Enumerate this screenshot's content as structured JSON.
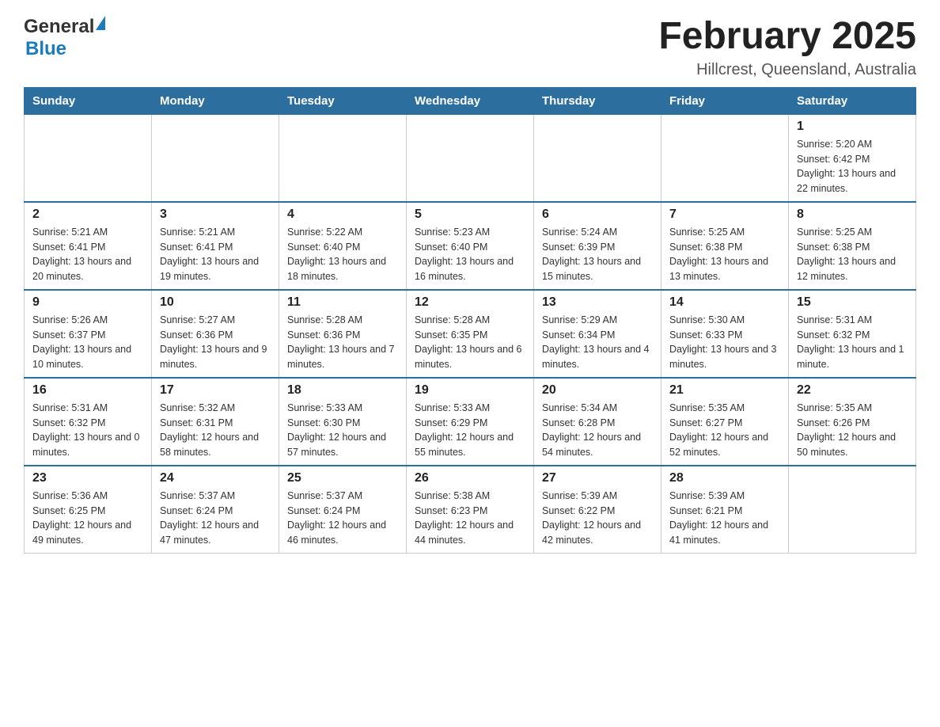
{
  "header": {
    "logo": {
      "general": "General",
      "blue": "Blue"
    },
    "title": "February 2025",
    "subtitle": "Hillcrest, Queensland, Australia"
  },
  "weekdays": [
    "Sunday",
    "Monday",
    "Tuesday",
    "Wednesday",
    "Thursday",
    "Friday",
    "Saturday"
  ],
  "weeks": [
    [
      {
        "day": "",
        "info": ""
      },
      {
        "day": "",
        "info": ""
      },
      {
        "day": "",
        "info": ""
      },
      {
        "day": "",
        "info": ""
      },
      {
        "day": "",
        "info": ""
      },
      {
        "day": "",
        "info": ""
      },
      {
        "day": "1",
        "info": "Sunrise: 5:20 AM\nSunset: 6:42 PM\nDaylight: 13 hours and 22 minutes."
      }
    ],
    [
      {
        "day": "2",
        "info": "Sunrise: 5:21 AM\nSunset: 6:41 PM\nDaylight: 13 hours and 20 minutes."
      },
      {
        "day": "3",
        "info": "Sunrise: 5:21 AM\nSunset: 6:41 PM\nDaylight: 13 hours and 19 minutes."
      },
      {
        "day": "4",
        "info": "Sunrise: 5:22 AM\nSunset: 6:40 PM\nDaylight: 13 hours and 18 minutes."
      },
      {
        "day": "5",
        "info": "Sunrise: 5:23 AM\nSunset: 6:40 PM\nDaylight: 13 hours and 16 minutes."
      },
      {
        "day": "6",
        "info": "Sunrise: 5:24 AM\nSunset: 6:39 PM\nDaylight: 13 hours and 15 minutes."
      },
      {
        "day": "7",
        "info": "Sunrise: 5:25 AM\nSunset: 6:38 PM\nDaylight: 13 hours and 13 minutes."
      },
      {
        "day": "8",
        "info": "Sunrise: 5:25 AM\nSunset: 6:38 PM\nDaylight: 13 hours and 12 minutes."
      }
    ],
    [
      {
        "day": "9",
        "info": "Sunrise: 5:26 AM\nSunset: 6:37 PM\nDaylight: 13 hours and 10 minutes."
      },
      {
        "day": "10",
        "info": "Sunrise: 5:27 AM\nSunset: 6:36 PM\nDaylight: 13 hours and 9 minutes."
      },
      {
        "day": "11",
        "info": "Sunrise: 5:28 AM\nSunset: 6:36 PM\nDaylight: 13 hours and 7 minutes."
      },
      {
        "day": "12",
        "info": "Sunrise: 5:28 AM\nSunset: 6:35 PM\nDaylight: 13 hours and 6 minutes."
      },
      {
        "day": "13",
        "info": "Sunrise: 5:29 AM\nSunset: 6:34 PM\nDaylight: 13 hours and 4 minutes."
      },
      {
        "day": "14",
        "info": "Sunrise: 5:30 AM\nSunset: 6:33 PM\nDaylight: 13 hours and 3 minutes."
      },
      {
        "day": "15",
        "info": "Sunrise: 5:31 AM\nSunset: 6:32 PM\nDaylight: 13 hours and 1 minute."
      }
    ],
    [
      {
        "day": "16",
        "info": "Sunrise: 5:31 AM\nSunset: 6:32 PM\nDaylight: 13 hours and 0 minutes."
      },
      {
        "day": "17",
        "info": "Sunrise: 5:32 AM\nSunset: 6:31 PM\nDaylight: 12 hours and 58 minutes."
      },
      {
        "day": "18",
        "info": "Sunrise: 5:33 AM\nSunset: 6:30 PM\nDaylight: 12 hours and 57 minutes."
      },
      {
        "day": "19",
        "info": "Sunrise: 5:33 AM\nSunset: 6:29 PM\nDaylight: 12 hours and 55 minutes."
      },
      {
        "day": "20",
        "info": "Sunrise: 5:34 AM\nSunset: 6:28 PM\nDaylight: 12 hours and 54 minutes."
      },
      {
        "day": "21",
        "info": "Sunrise: 5:35 AM\nSunset: 6:27 PM\nDaylight: 12 hours and 52 minutes."
      },
      {
        "day": "22",
        "info": "Sunrise: 5:35 AM\nSunset: 6:26 PM\nDaylight: 12 hours and 50 minutes."
      }
    ],
    [
      {
        "day": "23",
        "info": "Sunrise: 5:36 AM\nSunset: 6:25 PM\nDaylight: 12 hours and 49 minutes."
      },
      {
        "day": "24",
        "info": "Sunrise: 5:37 AM\nSunset: 6:24 PM\nDaylight: 12 hours and 47 minutes."
      },
      {
        "day": "25",
        "info": "Sunrise: 5:37 AM\nSunset: 6:24 PM\nDaylight: 12 hours and 46 minutes."
      },
      {
        "day": "26",
        "info": "Sunrise: 5:38 AM\nSunset: 6:23 PM\nDaylight: 12 hours and 44 minutes."
      },
      {
        "day": "27",
        "info": "Sunrise: 5:39 AM\nSunset: 6:22 PM\nDaylight: 12 hours and 42 minutes."
      },
      {
        "day": "28",
        "info": "Sunrise: 5:39 AM\nSunset: 6:21 PM\nDaylight: 12 hours and 41 minutes."
      },
      {
        "day": "",
        "info": ""
      }
    ]
  ]
}
